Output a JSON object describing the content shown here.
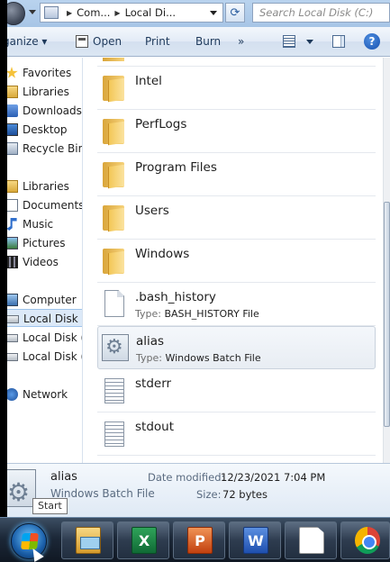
{
  "address_bar": {
    "crumbs": [
      "Com...",
      "Local Di..."
    ],
    "search_placeholder": "Search Local Disk (C:)"
  },
  "command_bar": {
    "organize": "ganize ▾",
    "open": "Open",
    "print": "Print",
    "burn": "Burn",
    "more": "»",
    "help": "?"
  },
  "nav_pane": {
    "favorites_header": "Favorites",
    "favorites": [
      "Libraries",
      "Downloads",
      "Desktop",
      "Recycle Bin"
    ],
    "libraries_header": "Libraries",
    "libraries": [
      "Documents",
      "Music",
      "Pictures",
      "Videos"
    ],
    "computer_header": "Computer",
    "drives": [
      "Local Disk (C",
      "Local Disk (D",
      "Local Disk (F"
    ],
    "network": "Network"
  },
  "file_list": {
    "type_label": "Type:",
    "items": [
      {
        "name": "Intel",
        "kind": "folder"
      },
      {
        "name": "PerfLogs",
        "kind": "folder"
      },
      {
        "name": "Program Files",
        "kind": "folder"
      },
      {
        "name": "Users",
        "kind": "folder"
      },
      {
        "name": "Windows",
        "kind": "folder"
      },
      {
        "name": ".bash_history",
        "kind": "file",
        "type": "BASH_HISTORY File"
      },
      {
        "name": "alias",
        "kind": "batch",
        "type": "Windows Batch File",
        "selected": true
      },
      {
        "name": "stderr",
        "kind": "text"
      },
      {
        "name": "stdout",
        "kind": "text"
      }
    ]
  },
  "details": {
    "name": "alias",
    "type": "Windows Batch File",
    "modified_label": "Date modified:",
    "modified_value": "12/23/2021 7:04 PM",
    "size_label": "Size:",
    "size_value": "72 bytes"
  },
  "tooltip": "Start",
  "taskbar": {
    "excel": "X",
    "powerpoint": "P",
    "word": "W"
  },
  "colors": {
    "selection": "#dce9f8",
    "taskbar": "#1c2838",
    "command_text": "#1e395b"
  }
}
